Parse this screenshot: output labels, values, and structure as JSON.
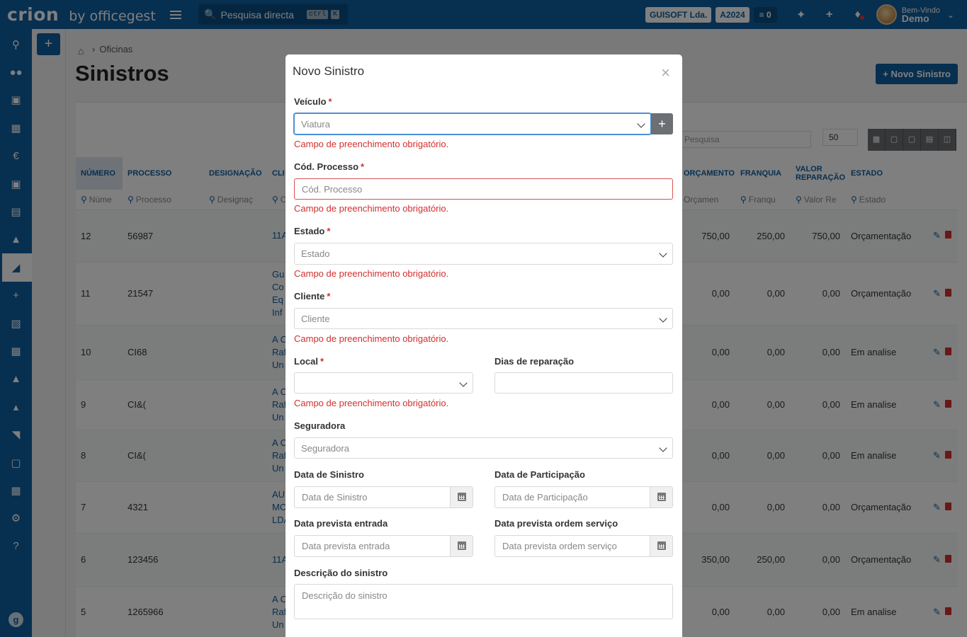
{
  "topbar": {
    "logo_main": "crion",
    "logo_sub": "by officegest",
    "search_label": "Pesquisa directa",
    "kbd_ctrl": "ctrl",
    "kbd_k": "K",
    "company": "GUISOFT Lda.",
    "year": "A2024",
    "tasks_count": "0",
    "greeting": "Bem-Vindo",
    "username": "Demo"
  },
  "sidebar": {
    "items": [
      "search-icon",
      "users-icon",
      "book-icon",
      "warehouse-icon",
      "euro-icon",
      "cart-icon",
      "money-icon",
      "car-service-icon",
      "car-icon",
      "plus-icon",
      "calculator-icon",
      "boxes-icon",
      "sitemap-icon",
      "bank-icon",
      "chart-icon",
      "file-icon",
      "table-icon",
      "cogs-icon",
      "help-icon"
    ],
    "active_index": 8
  },
  "page": {
    "breadcrumb": "Oficinas",
    "title": "Sinistros",
    "new_button": "Novo Sinistro",
    "table_search_placeholder": "Pesquisa",
    "page_size": "50"
  },
  "table": {
    "headers": [
      "NÚMERO",
      "PROCESSO",
      "DESIGNAÇÃO",
      "CLI",
      "ORÇAMENTO",
      "FRANQUIA",
      "VALOR REPARAÇÃO",
      "ESTADO"
    ],
    "filters": [
      "Núme",
      "Processo",
      "Designaç",
      "C",
      "Orçamen",
      "Franqu",
      "Valor Re",
      "Estado"
    ],
    "rows": [
      {
        "numero": "12",
        "processo": "56987",
        "cliente": "11A",
        "orcamento": "750,00",
        "franquia": "250,00",
        "valor": "750,00",
        "estado": "Orçamentação"
      },
      {
        "numero": "11",
        "processo": "21547",
        "cliente": "Gu\nCo\nEq\nInf",
        "orcamento": "0,00",
        "franquia": "0,00",
        "valor": "0,00",
        "estado": "Orçamentação"
      },
      {
        "numero": "10",
        "processo": "CI68",
        "cliente": "A C\nRaf\nUn",
        "orcamento": "0,00",
        "franquia": "0,00",
        "valor": "0,00",
        "estado": "Em analise"
      },
      {
        "numero": "9",
        "processo": "CI&(",
        "cliente": "A C\nRaf\nUn",
        "orcamento": "0,00",
        "franquia": "0,00",
        "valor": "0,00",
        "estado": "Em analise"
      },
      {
        "numero": "8",
        "processo": "CI&(",
        "cliente": "A C\nRaf\nUn",
        "orcamento": "0,00",
        "franquia": "0,00",
        "valor": "0,00",
        "estado": "Em analise"
      },
      {
        "numero": "7",
        "processo": "4321",
        "cliente": "AU\nMC\nLDA",
        "orcamento": "0,00",
        "franquia": "0,00",
        "valor": "0,00",
        "estado": "Orçamentação"
      },
      {
        "numero": "6",
        "processo": "123456",
        "cliente": "11A",
        "orcamento": "350,00",
        "franquia": "250,00",
        "valor": "0,00",
        "estado": "Orçamentação"
      },
      {
        "numero": "5",
        "processo": "1265966",
        "cliente": "A C\nRaf\nUn",
        "orcamento": "0,00",
        "franquia": "0,00",
        "valor": "0,00",
        "estado": "Em analise"
      }
    ]
  },
  "modal": {
    "title": "Novo Sinistro",
    "required_mark": "*",
    "error_text": "Campo de preenchimento obrigatório.",
    "veiculo": {
      "label": "Veículo",
      "placeholder": "Viatura"
    },
    "cod_processo": {
      "label": "Cód. Processo",
      "placeholder": "Cód. Processo"
    },
    "estado": {
      "label": "Estado",
      "placeholder": "Estado"
    },
    "cliente": {
      "label": "Cliente",
      "placeholder": "Cliente"
    },
    "local": {
      "label": "Local",
      "value": ""
    },
    "dias_reparacao": {
      "label": "Dias de reparação",
      "value": ""
    },
    "seguradora": {
      "label": "Seguradora",
      "placeholder": "Seguradora"
    },
    "data_sinistro": {
      "label": "Data de Sinistro",
      "placeholder": "Data de Sinistro"
    },
    "data_participacao": {
      "label": "Data de Participação",
      "placeholder": "Data de Participação"
    },
    "data_prevista_entrada": {
      "label": "Data prevista entrada",
      "placeholder": "Data prevista entrada"
    },
    "data_prevista_os": {
      "label": "Data prevista ordem serviço",
      "placeholder": "Data prevista ordem serviço"
    },
    "descricao": {
      "label": "Descrição do sinistro",
      "placeholder": "Descrição do sinistro"
    }
  }
}
